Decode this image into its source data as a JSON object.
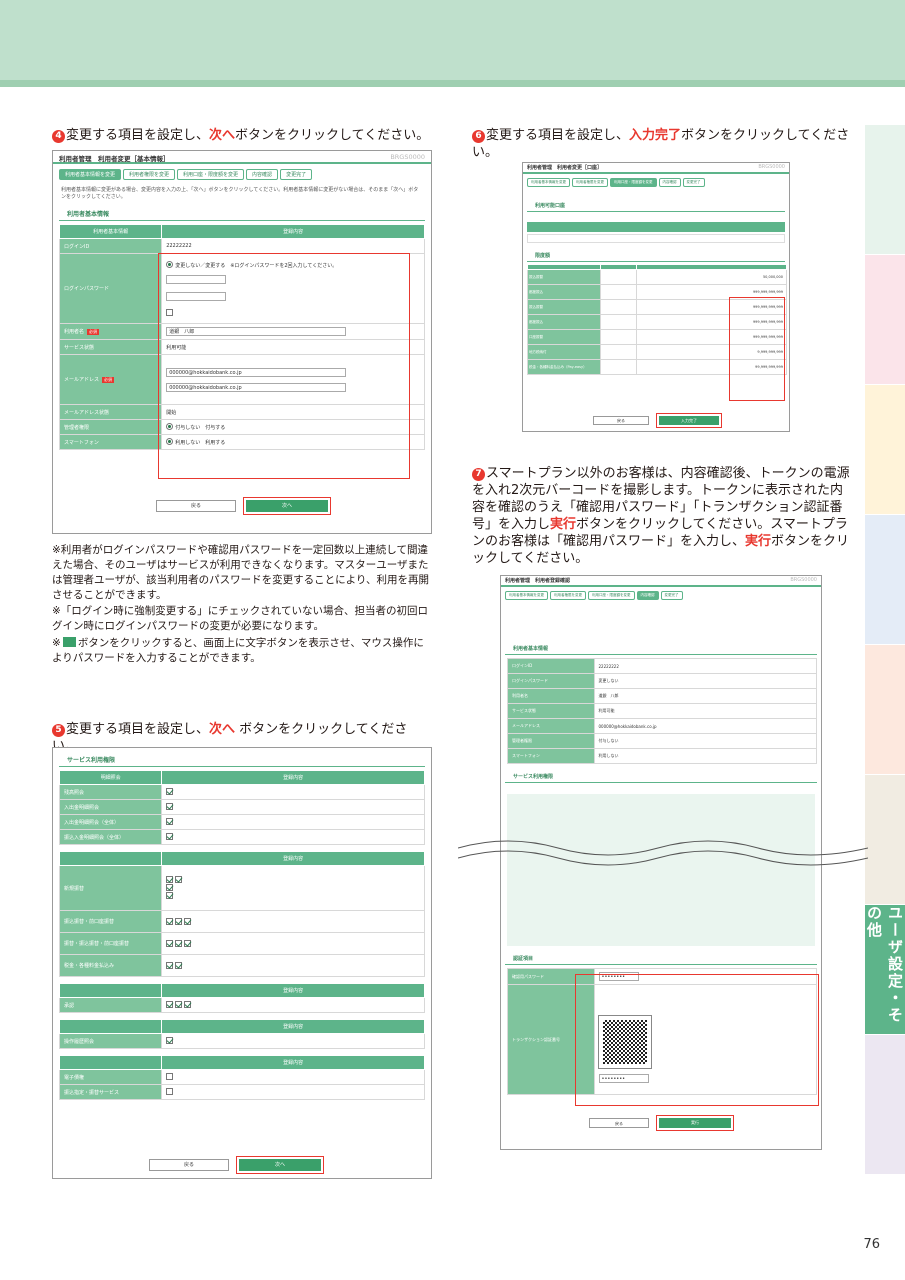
{
  "page_number": "76",
  "sidebar_label": "ユーザ設定・その他",
  "colors": {
    "accent": "#5db48a",
    "red": "#e8382f",
    "band": "#bfe0cc"
  },
  "step4": {
    "num": "4",
    "pre": "変更する項目を設定し、",
    "red": "次へ",
    "post": "ボタンをクリックしてください。"
  },
  "step5": {
    "num": "5",
    "pre": "変更する項目を設定し、",
    "red": "次へ",
    "post": " ボタンをクリックしてください。"
  },
  "step6": {
    "num": "6",
    "pre": "変更する項目を設定し、",
    "red": "入力完了",
    "post": "ボタンをクリックしてください。"
  },
  "step7": {
    "num": "7",
    "a": "スマートプラン以外のお客様は、内容確認後、トークンの電源を入れ2次元バーコードを撮影します。トークンに表示された内容を確認のうえ「確認用パスワード」「トランザクション認証番号」を入力し",
    "red1": "実行",
    "b": "ボタンをクリックしてください。スマートプランのお客様は「確認用パスワード」を入力し、",
    "red2": "実行",
    "c": "ボタンをクリックしてください。"
  },
  "notes": {
    "n1": "※利用者がログインパスワードや確認用パスワードを一定回数以上連続して間違えた場合、そのユーザはサービスが利用できなくなります。マスターユーザまたは管理者ユーザが、該当利用者のパスワードを変更することにより、利用を再開させることができます。",
    "n2": "※「ログイン時に強制変更する」にチェックされていない場合、担当者の初回ログイン時にログインパスワードの変更が必要になります。",
    "n3a": "※",
    "n3b": "ボタンをクリックすると、画面上に文字ボタンを表示させ、マウス操作によりパスワードを入力することができます。"
  },
  "shot4": {
    "title": "利用者管理　利用者変更［基本情報］",
    "code": "BRGS0000",
    "crumbs": [
      "利用者基本情報を変更",
      "利用者権限を変更",
      "利用口座・限度額を変更",
      "内容確認",
      "変更完了"
    ],
    "intro": "利用者基本情報に変更がある場合、変更内容を入力の上、「次へ」ボタンをクリックしてください。利用者基本情報に変更がない場合は、そのまま「次へ」ボタンをクリックしてください。",
    "section": "利用者基本情報",
    "th": [
      "利用者基本情報",
      "登録内容"
    ],
    "rows": [
      {
        "k": "ログインID",
        "v": "22222222"
      },
      {
        "k": "ログインパスワード",
        "v": "変更しない／変更する　※ログインパスワードを2回入力してください。"
      },
      {
        "k": "利用者名",
        "v": "道銀　八郎",
        "req": "必須"
      },
      {
        "k": "サービス状態",
        "v": "利用可能"
      },
      {
        "k": "メールアドレス",
        "v": "000000@hokkaidobank.co.jp",
        "req": "必須"
      },
      {
        "k": "メールアドレス状態",
        "v": "開始"
      },
      {
        "k": "管理者権限",
        "v": "付与しない　付与する"
      },
      {
        "k": "スマートフォン",
        "v": "利用しない　利用する"
      }
    ],
    "back": "戻る",
    "next": "次へ"
  },
  "shot5": {
    "title": "サービス利用権限",
    "th": [
      "明細照会",
      "登録内容"
    ],
    "rows1": [
      "残高照会",
      "入出金明細照会",
      "入出金明細照会（全体）",
      "振込入金明細照会（全体）"
    ],
    "rows2": [
      "新規振替",
      "振込振替・前口座振替",
      "振替・振込振替・前口座振替",
      "税金・各種料金払込み"
    ],
    "rows3": [
      "承認"
    ],
    "rows4": [
      "操作履歴照会"
    ],
    "rows5": [
      "電子債権",
      "振込指定・振替サービス"
    ],
    "back": "戻る",
    "next": "次へ"
  },
  "shot6": {
    "title": "利用者管理　利用者変更［口座］",
    "code": "BRGS0000",
    "section1": "利用可能口座",
    "section2": "限度額",
    "limit_rows": [
      "振込振替",
      "都度振込",
      "振込振替",
      "都度振込",
      "口座振替",
      "税金・各種料金払込み（Pay-easy）",
      "地方税納付"
    ],
    "limits": [
      "50,000,000",
      "999,999,999,999",
      "999,999,999,999",
      "999,999,999,999",
      "999,999,999,999",
      "9,999,999,999",
      "99,999,999,999"
    ],
    "back": "戻る",
    "done": "入力完了"
  },
  "shot7": {
    "title": "利用者管理　利用者登録確認",
    "code": "BRGS0000",
    "section1": "利用者基本情報",
    "rows": [
      {
        "k": "ログインID",
        "v": "22222222"
      },
      {
        "k": "ログインパスワード",
        "v": "変更しない"
      },
      {
        "k": "利用者名",
        "v": "道銀　八郎"
      },
      {
        "k": "サービス状態",
        "v": "利用可能"
      },
      {
        "k": "メールアドレス",
        "v": "000000@hokkaidobank.co.jp"
      },
      {
        "k": "管理者権限",
        "v": "付与しない"
      },
      {
        "k": "スマートフォン",
        "v": "利用しない"
      }
    ],
    "section2": "サービス利用権限",
    "section3": "認証項目",
    "pwd_label": "確認用パスワード",
    "tx_label": "トランザクション認証番号",
    "back": "戻る",
    "exec": "実行"
  }
}
